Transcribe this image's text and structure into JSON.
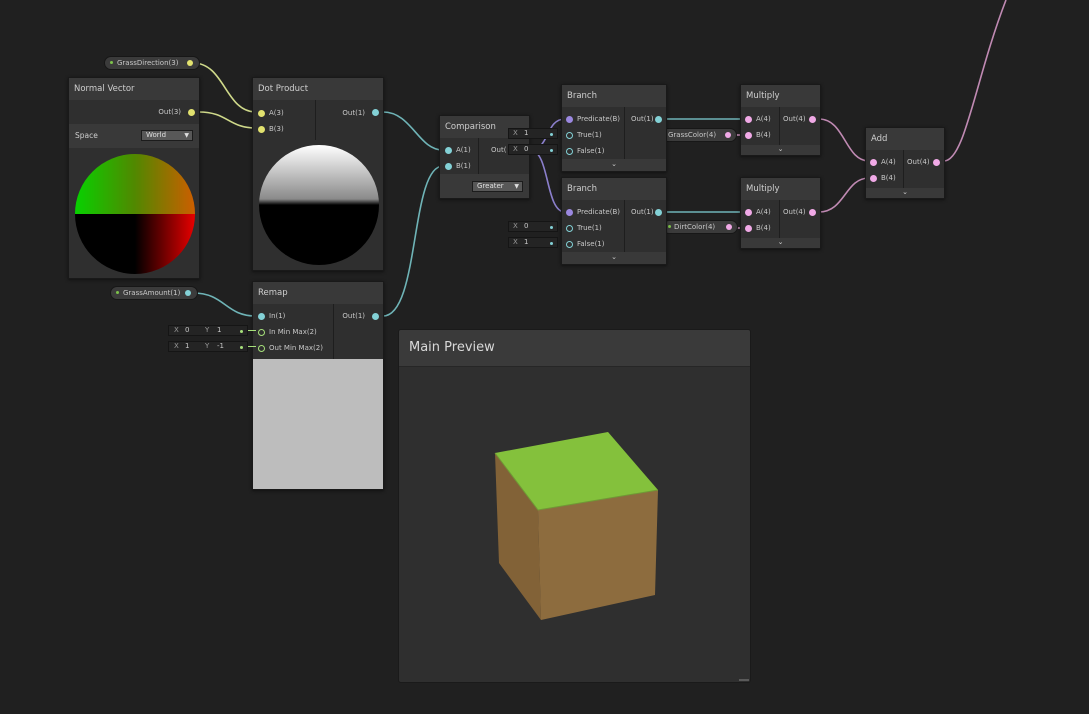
{
  "colors": {
    "background": "#202020",
    "node_body": "#2f2f2f",
    "node_header": "#393939",
    "vector3_port": "#e2e26f",
    "float_port": "#83d1d6",
    "vector4_port": "#f0a9e6",
    "boolean_port": "#9b88e0",
    "vector3_wire": "#cfd98a",
    "float_wire": "#6fb4b7",
    "vector4_wire": "#c08ab3",
    "boolean_wire": "#8b7fcc",
    "grass_top": "#84c13c",
    "dirt_side": "#8a6a3d"
  },
  "properties": {
    "grass_direction": "GrassDirection(3)",
    "grass_amount": "GrassAmount(1)",
    "grass_color": "GrassColor(4)",
    "dirt_color": "DirtColor(4)"
  },
  "normal_vector": {
    "title": "Normal Vector",
    "out": "Out(3)",
    "space_label": "Space",
    "space_value": "World"
  },
  "dot_product": {
    "title": "Dot Product",
    "in_a": "A(3)",
    "in_b": "B(3)",
    "out": "Out(1)"
  },
  "remap": {
    "title": "Remap",
    "in": "In(1)",
    "in_min_max": "In Min Max(2)",
    "out_min_max": "Out Min Max(2)",
    "out": "Out(1)",
    "in_min_max_x_label": "X",
    "in_min_max_x": "0",
    "in_min_max_y_label": "Y",
    "in_min_max_y": "1",
    "out_min_max_x_label": "X",
    "out_min_max_x": "1",
    "out_min_max_y_label": "Y",
    "out_min_max_y": "-1"
  },
  "comparison": {
    "title": "Comparison",
    "in_a": "A(1)",
    "in_b": "B(1)",
    "out": "Out(",
    "mode": "Greater"
  },
  "branch_top": {
    "title": "Branch",
    "predicate": "Predicate(B)",
    "true": "True(1)",
    "false": "False(1)",
    "out": "Out(1)",
    "true_x_label": "X",
    "true_x": "1",
    "false_x_label": "X",
    "false_x": "0"
  },
  "branch_bottom": {
    "title": "Branch",
    "predicate": "Predicate(B)",
    "true": "True(1)",
    "false": "False(1)",
    "out": "Out(1)",
    "true_x_label": "X",
    "true_x": "0",
    "false_x_label": "X",
    "false_x": "1"
  },
  "multiply_top": {
    "title": "Multiply",
    "in_a": "A(4)",
    "in_b": "B(4)",
    "out": "Out(4)"
  },
  "multiply_bottom": {
    "title": "Multiply",
    "in_a": "A(4)",
    "in_b": "B(4)",
    "out": "Out(4)"
  },
  "add": {
    "title": "Add",
    "in_a": "A(4)",
    "in_b": "B(4)",
    "out": "Out(4)"
  },
  "main_preview": {
    "title": "Main Preview"
  },
  "collapse_glyph": "⌄"
}
